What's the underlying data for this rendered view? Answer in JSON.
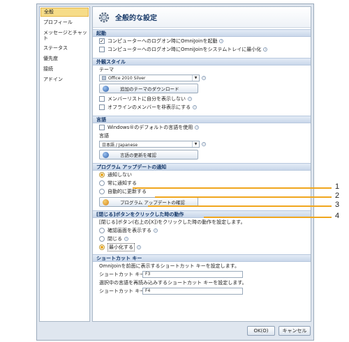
{
  "sidebar": {
    "items": [
      {
        "label": "全般"
      },
      {
        "label": "プロフィール"
      },
      {
        "label": "メッセージとチャット"
      },
      {
        "label": "ステータス"
      },
      {
        "label": "優先度"
      },
      {
        "label": "接続"
      },
      {
        "label": "アドイン"
      }
    ]
  },
  "main": {
    "title": "全般的な設定",
    "sections": {
      "startup": {
        "title": "起動",
        "opt1": "コンピューターへのログオン時にOmniJoinを起動",
        "opt2": "コンピューターへのログオン時にOmniJoinをシステムトレイに最小化"
      },
      "appearance": {
        "title": "外観スタイル",
        "theme_label": "テーマ",
        "theme_value": "Office 2010 Silver",
        "download_button": "追加のテーマのダウンロード",
        "opt1": "メンバーリストに自分を表示しない",
        "opt2": "オフラインのメンバーを非表示にする"
      },
      "language": {
        "title": "言語",
        "use_windows_default": "Windows®のデフォルトの言語を使用",
        "lang_label": "言語",
        "lang_value": "日本語 / Japanese",
        "update_button": "言語の更新を確認"
      },
      "updates": {
        "title": "プログラム アップデートの通知",
        "opt_none": "通知しない",
        "opt_always": "常に通知する",
        "opt_auto": "自動的に更新する",
        "check_button": "プログラム アップデートの確認"
      },
      "close_behavior": {
        "title": "[閉じる]ボタンをクリックした時の動作",
        "description": "[閉じる]ボタン(右上の[X])をクリックした時の動作を設定します。",
        "opt_confirm": "確認画面を表示する",
        "opt_close": "閉じる",
        "opt_minimize": "最小化する"
      },
      "shortcuts": {
        "title": "ショートカット キー",
        "desc1": "OmniJoinを前面に表示するショートカット キーを設定します。",
        "label1": "ショートカット キー",
        "value1": "F3",
        "desc2": "選択中の言語を再読み込みするショートカット キーを設定します。",
        "label2": "ショートカット キー",
        "value2": "F4"
      }
    }
  },
  "footer": {
    "ok": "OK(O)",
    "cancel": "キャンセル"
  },
  "callouts": [
    "1",
    "2",
    "3",
    "4"
  ],
  "state": {
    "startup_opt1_checked": true,
    "startup_opt2_checked": false,
    "appearance_opt1_checked": false,
    "appearance_opt2_checked": false,
    "use_windows_default_checked": false,
    "updates_selected": "opt_none",
    "close_selected": "opt_minimize"
  },
  "colors": {
    "accent": "#f0a61d",
    "section_header": "#c9d7ea",
    "title_text": "#1b3c6b"
  }
}
